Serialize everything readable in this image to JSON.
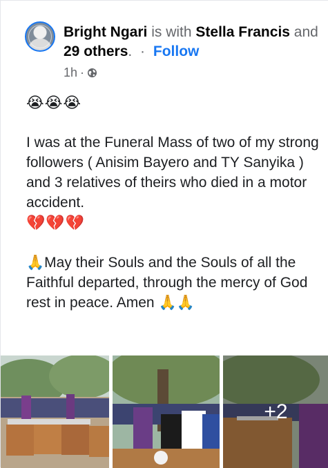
{
  "post": {
    "author": "Bright Ngari",
    "with_text": "is with",
    "tagged": "Stella Francis",
    "and_text": "and",
    "others": "29 others",
    "separator": "·",
    "follow_label": "Follow",
    "time": "1h",
    "meta_dot": "·",
    "audience_icon": "globe-icon",
    "emoji_top": "😭😭😭",
    "paragraph1": "I was at the Funeral Mass of two of my strong followers ( Anisim Bayero and TY Sanyika ) and 3 relatives of theirs who died in a motor accident.",
    "emoji_broken": "💔💔💔",
    "paragraph2": "🙏May their Souls and the Souls of all the Faithful departed, through the mercy of God rest in peace. Amen 🙏🙏",
    "more_photos": "+2"
  },
  "colors": {
    "link": "#1877f2",
    "secondary_text": "#65676b",
    "primary_text": "#050505"
  }
}
